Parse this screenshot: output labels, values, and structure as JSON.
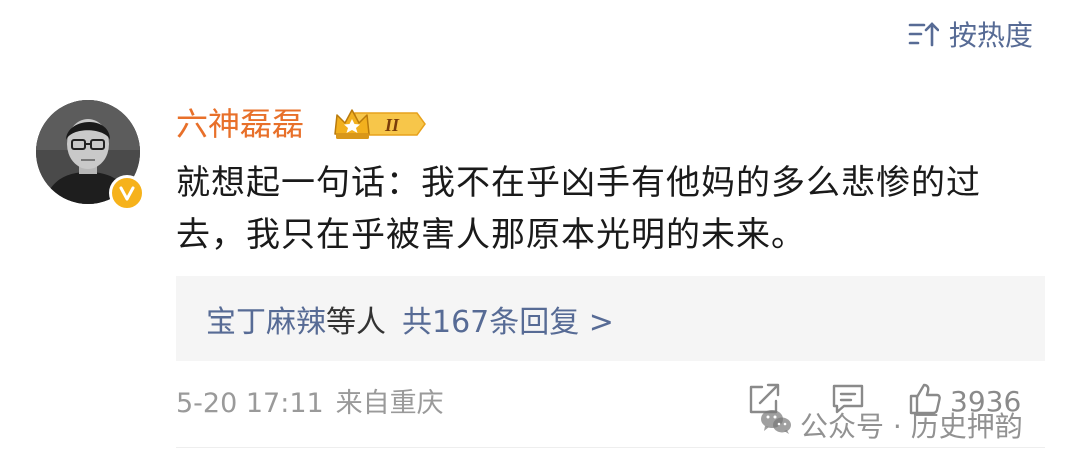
{
  "sort": {
    "label": "按热度",
    "icon": "sort-icon"
  },
  "comment": {
    "username": "六神磊磊",
    "badge_level": "II",
    "text": "就想起一句话：我不在乎凶手有他妈的多么悲惨的过去，我只在乎被害人那原本光明的未来。",
    "replies": {
      "names": "宝丁麻辣",
      "suffix": "等人",
      "count_text": "共167条回复 >"
    },
    "date": "5-20 17:11",
    "location": "来自重庆",
    "like_count": "3936"
  },
  "watermark": {
    "text": "公众号 · 历史押韵"
  },
  "colors": {
    "link": "#576b95",
    "username": "#e8702a",
    "verified": "#f6b21b",
    "meta": "#9a9a9a"
  }
}
